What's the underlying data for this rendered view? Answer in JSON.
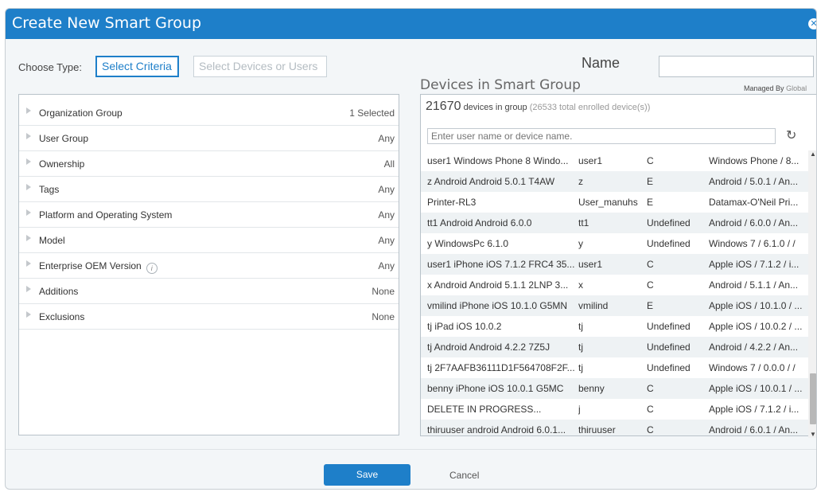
{
  "dialog": {
    "title": "Create New Smart Group"
  },
  "choose_type": {
    "label": "Choose Type:",
    "criteria_button": "Select Criteria",
    "devices_button": "Select Devices or Users"
  },
  "name": {
    "label": "Name",
    "value": ""
  },
  "devices_panel": {
    "title": "Devices in Smart Group",
    "managed_by_label": "Managed By",
    "managed_by_value": "Global",
    "count": "21670",
    "count_text": "devices in group",
    "total_text": "(26533 total enrolled device(s))",
    "search_placeholder": "Enter user name or device name."
  },
  "criteria": [
    {
      "label": "Organization Group",
      "value": "1 Selected"
    },
    {
      "label": "User Group",
      "value": "Any"
    },
    {
      "label": "Ownership",
      "value": "All"
    },
    {
      "label": "Tags",
      "value": "Any"
    },
    {
      "label": "Platform and Operating System",
      "value": "Any"
    },
    {
      "label": "Model",
      "value": "Any"
    },
    {
      "label": "Enterprise OEM Version",
      "value": "Any"
    },
    {
      "label": "Additions",
      "value": "None"
    },
    {
      "label": "Exclusions",
      "value": "None"
    }
  ],
  "devices": [
    {
      "name": "user1 Windows Phone 8 Windo...",
      "user": "user1",
      "own": "C",
      "os": "Windows Phone / 8..."
    },
    {
      "name": "z Android Android 5.0.1 T4AW",
      "user": "z",
      "own": "E",
      "os": "Android / 5.0.1 / An..."
    },
    {
      "name": "Printer-RL3",
      "user": "User_manuhs",
      "own": "E",
      "os": "Datamax-O'Neil Pri..."
    },
    {
      "name": "tt1 Android Android 6.0.0",
      "user": "tt1",
      "own": "Undefined",
      "os": "Android / 6.0.0 / An..."
    },
    {
      "name": "y WindowsPc 6.1.0",
      "user": "y",
      "own": "Undefined",
      "os": "Windows 7 / 6.1.0 / /"
    },
    {
      "name": "user1 iPhone iOS 7.1.2 FRC4 35...",
      "user": "user1",
      "own": "C",
      "os": "Apple iOS / 7.1.2 / i..."
    },
    {
      "name": "x Android Android 5.1.1 2LNP 3...",
      "user": "x",
      "own": "C",
      "os": "Android / 5.1.1 / An..."
    },
    {
      "name": "vmilind iPhone iOS 10.1.0 G5MN",
      "user": "vmilind",
      "own": "E",
      "os": "Apple iOS / 10.1.0 / ..."
    },
    {
      "name": "tj iPad iOS 10.0.2",
      "user": "tj",
      "own": "Undefined",
      "os": "Apple iOS / 10.0.2 / ..."
    },
    {
      "name": "tj Android Android 4.2.2 7Z5J",
      "user": "tj",
      "own": "Undefined",
      "os": "Android / 4.2.2 / An..."
    },
    {
      "name": "tj 2F7AAFB36111D1F564708F2F...",
      "user": "tj",
      "own": "Undefined",
      "os": "Windows 7 / 0.0.0 / /"
    },
    {
      "name": "benny iPhone iOS 10.0.1 G5MC",
      "user": "benny",
      "own": "C",
      "os": "Apple iOS / 10.0.1 / ..."
    },
    {
      "name": "DELETE IN PROGRESS...",
      "user": "j",
      "own": "C",
      "os": "Apple iOS / 7.1.2 / i..."
    },
    {
      "name": "thiruuser android Android 6.0.1...",
      "user": "thiruuser",
      "own": "C",
      "os": "Android / 6.0.1 / An..."
    }
  ],
  "footer": {
    "save": "Save",
    "cancel": "Cancel"
  },
  "icons": {
    "close": "close-icon",
    "refresh": "refresh-icon",
    "info": "info-icon",
    "expand": "expand-arrow-icon"
  },
  "colors": {
    "accent": "#1e7fc9"
  }
}
